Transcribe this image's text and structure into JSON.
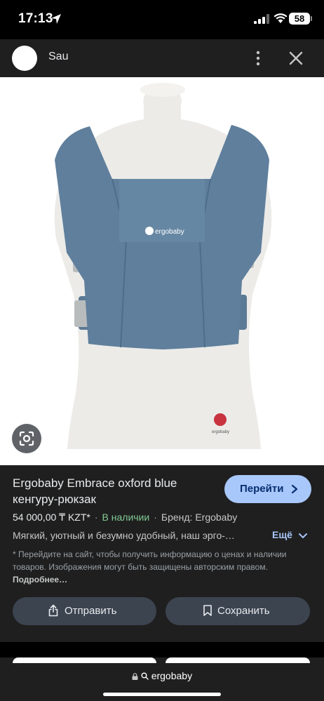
{
  "status_bar": {
    "time": "17:13",
    "battery": "58"
  },
  "viewer": {
    "source_name": "Sau"
  },
  "image": {
    "logo_text": "ergobaby",
    "tag_text": "ergobaby"
  },
  "product": {
    "title": "Ergobaby Embrace oxford blue кенгуру-рюкзак",
    "go_button": "Перейти",
    "price": "54 000,00 ₸ KZT*",
    "separator": "·",
    "availability": "В наличии",
    "brand": "Бренд: Ergobaby",
    "description": "Мягкий, уютный и безумно удобный, наш эрго-…",
    "more_label": "Ещё",
    "note": "* Перейдите на сайт, чтобы получить информацию о ценах и наличии товаров. Изображения могут быть защищены авторским правом.",
    "note_more": "Подробнее…",
    "share_button": "Отправить",
    "save_button": "Сохранить"
  },
  "browser": {
    "url": "ergobaby"
  },
  "colors": {
    "panel": "#1f1f1f",
    "accent": "#a8c7fa",
    "stock_green": "#81c995",
    "carrier_blue": "#5f7f9c"
  },
  "icons": [
    "location-arrow-icon",
    "signal-icon",
    "wifi-icon",
    "battery-icon",
    "more-vert-icon",
    "close-icon",
    "lens-icon",
    "chevron-right-icon",
    "chevron-down-icon",
    "share-icon",
    "bookmark-icon",
    "lock-icon",
    "search-icon"
  ]
}
